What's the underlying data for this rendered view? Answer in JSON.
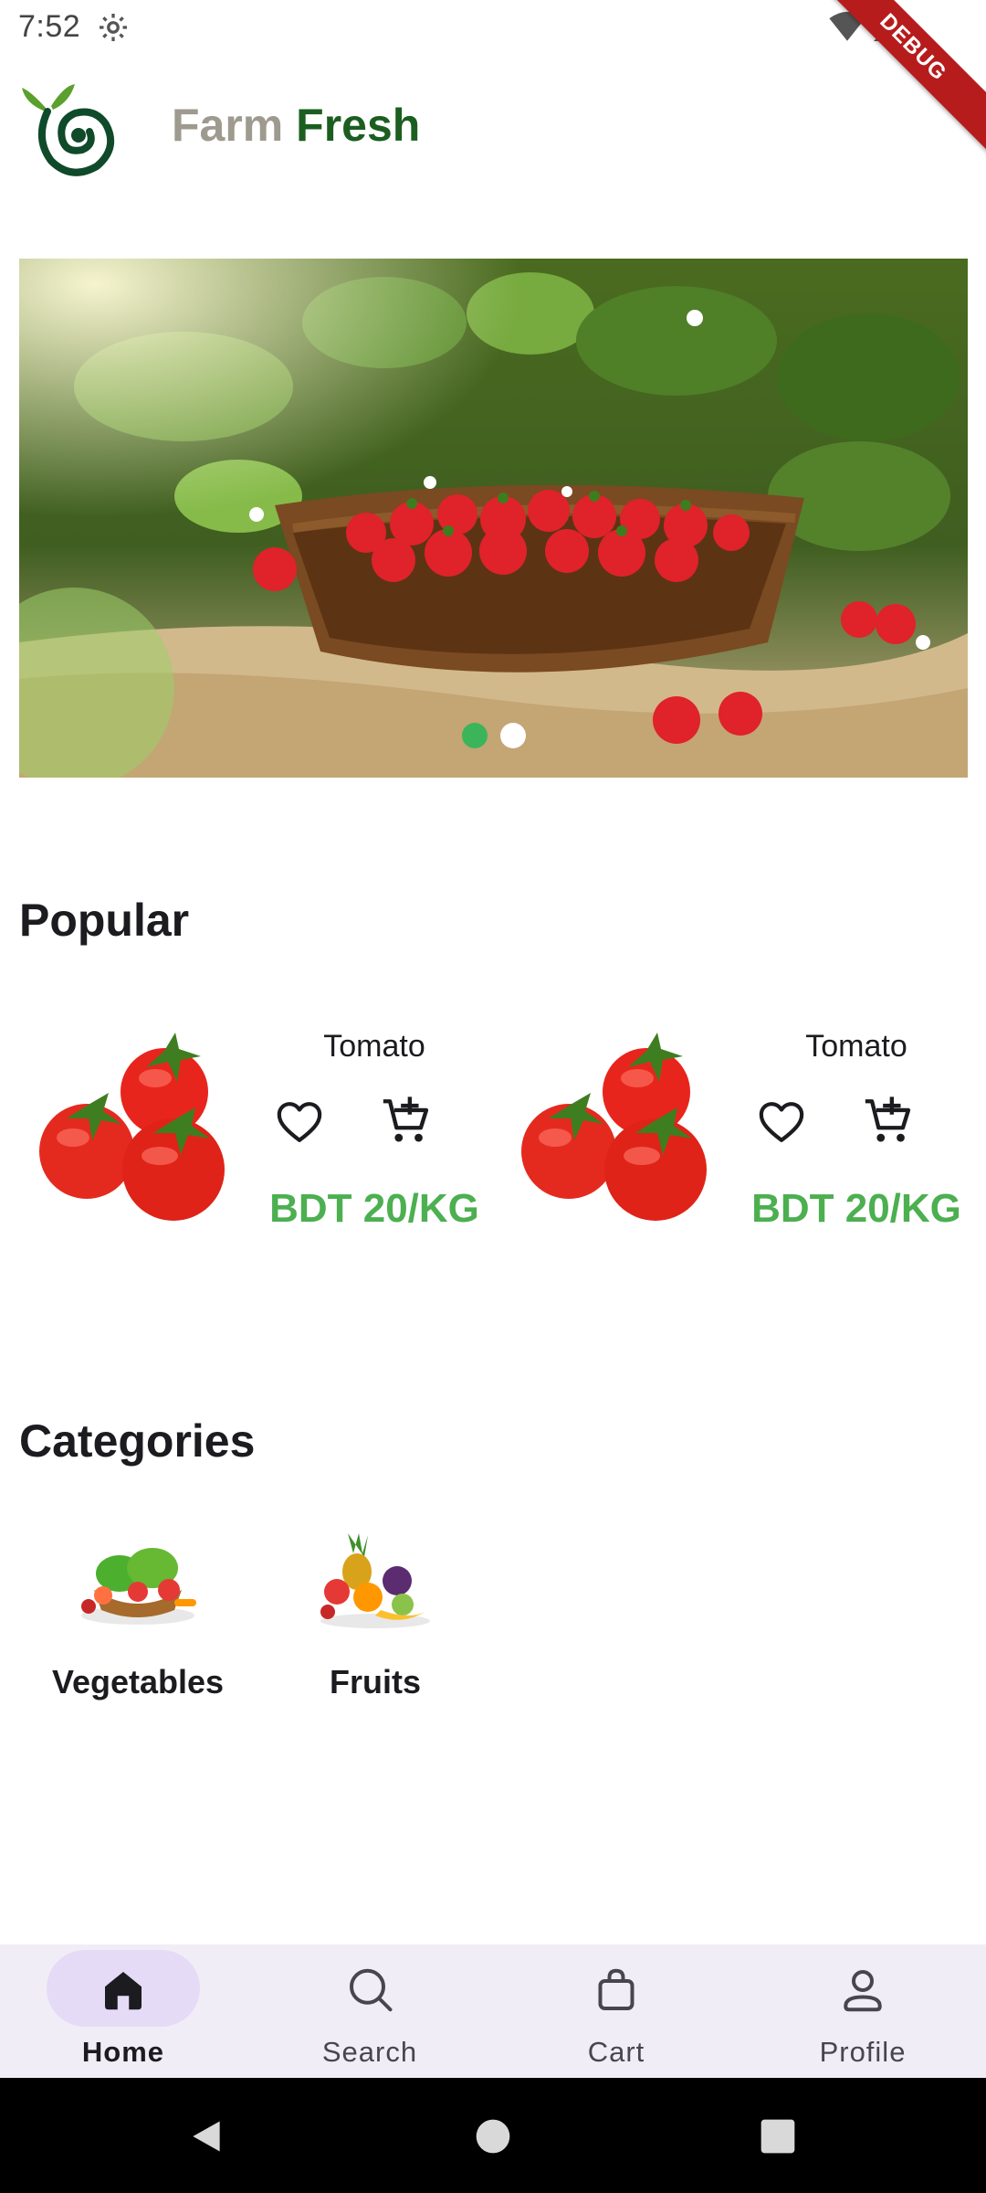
{
  "status_bar": {
    "time": "7:52",
    "debug_label": "DEBUG"
  },
  "header": {
    "brand_part1": "Farm",
    "brand_part2": "Fresh"
  },
  "carousel": {
    "slide_count": 2,
    "active_index": 0
  },
  "popular": {
    "title": "Popular",
    "products": [
      {
        "name": "Tomato",
        "price": "BDT 20/KG"
      },
      {
        "name": "Tomato",
        "price": "BDT 20/KG"
      }
    ]
  },
  "categories": {
    "title": "Categories",
    "items": [
      {
        "label": "Vegetables"
      },
      {
        "label": "Fruits"
      }
    ]
  },
  "bottom_nav": {
    "items": [
      {
        "label": "Home",
        "icon": "home-icon",
        "active": true
      },
      {
        "label": "Search",
        "icon": "search-icon",
        "active": false
      },
      {
        "label": "Cart",
        "icon": "bag-icon",
        "active": false
      },
      {
        "label": "Profile",
        "icon": "person-icon",
        "active": false
      }
    ]
  },
  "colors": {
    "brand_dark": "#1b5e20",
    "brand_muted": "#9e9a8f",
    "price_green": "#4caf50",
    "nav_bg": "#f1edf6",
    "nav_active_pill": "#e6dbf6",
    "dot_active": "#3cb55a"
  }
}
